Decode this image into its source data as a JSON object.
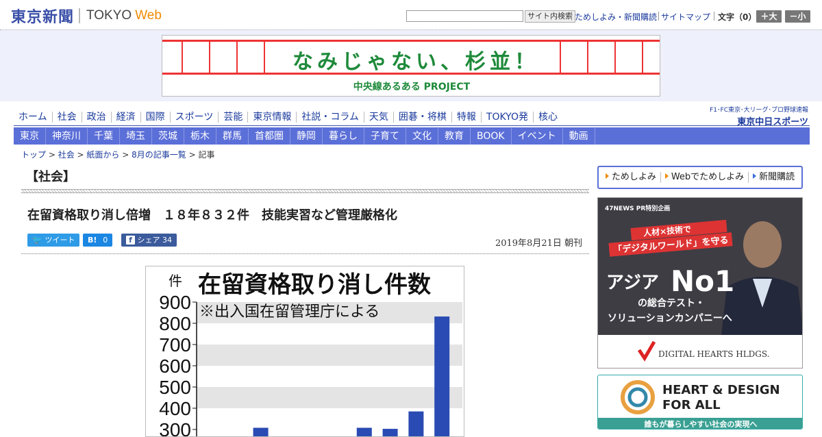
{
  "header": {
    "logo_jp": "東京新聞",
    "logo_en": "TOKYO",
    "logo_web": "Web",
    "search_button": "サイト内検索",
    "links": [
      "ためしよみ・新聞購読",
      "サイトマップ"
    ],
    "font_size_label": "文字（0）",
    "size_up": "＋大",
    "size_down": "－小"
  },
  "banner": {
    "title": "なみじゃない、杉並！",
    "subtitle": "中央線あるある PROJECT"
  },
  "nav_primary": [
    "ホーム",
    "社会",
    "政治",
    "経済",
    "国際",
    "スポーツ",
    "芸能",
    "東京情報",
    "社説・コラム",
    "天気",
    "囲碁・将棋",
    "特報",
    "TOKYO発",
    "核心"
  ],
  "chunichi": {
    "line1": "F1･FC東京･大リーグ･プロ野球速報",
    "line2": "東京中日スポーツ"
  },
  "nav_secondary": [
    "東京",
    "神奈川",
    "千葉",
    "埼玉",
    "茨城",
    "栃木",
    "群馬",
    "首都圏",
    "静岡",
    "暮らし",
    "子育て",
    "文化",
    "教育",
    "BOOK",
    "イベント",
    "動画"
  ],
  "breadcrumb": {
    "items": [
      "トップ",
      "社会",
      "紙面から",
      "8月の記事一覧"
    ],
    "current": "記事"
  },
  "article": {
    "section": "【社会】",
    "headline": "在留資格取り消し倍増　１８年８３２件　技能実習など管理厳格化",
    "date": "2019年8月21日 朝刊",
    "share": {
      "tweet": "ツイート",
      "hatena": "B!",
      "hatena_count": "0",
      "fb": "シェア",
      "fb_count": "34"
    }
  },
  "chart_data": {
    "type": "bar",
    "title": "在留資格取り消し件数",
    "subtitle": "※出入国在留管理庁による",
    "ylabel": "件",
    "yticks": [
      300,
      400,
      500,
      600,
      700,
      800,
      900
    ],
    "ylim": [
      300,
      900
    ],
    "values": [
      null,
      null,
      308,
      null,
      null,
      null,
      308,
      303,
      385,
      832
    ],
    "color": "#2a4bb3"
  },
  "sidebar": {
    "subscribe_links": [
      "ためしよみ",
      "Webでためしよみ",
      "新聞購読"
    ],
    "ad1": {
      "tag": "47NEWS PR特別企画",
      "line1": "人材×技術で",
      "line2": "「デジタルワールド」を守る",
      "line3a": "アジア",
      "line3b": "No1",
      "line4": "の総合テスト・",
      "line5": "ソリューションカンパニーへ",
      "brand": "DIGITAL HEARTS HLDGS."
    },
    "ad2": {
      "title1": "HEART & DESIGN",
      "title2": "FOR ALL",
      "caption": "誰もが暮らしやすい社会の実現へ"
    }
  },
  "colors": {
    "nav_blue": "#5b6fd8",
    "link_blue": "#1a3a9c",
    "banner_green": "#1e8a3a",
    "banner_red": "#e33"
  }
}
